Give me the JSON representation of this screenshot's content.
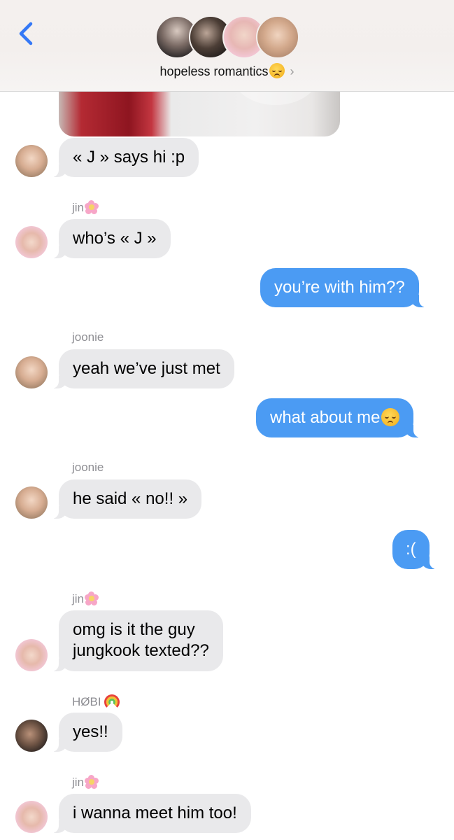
{
  "header": {
    "title": "hopeless romantics",
    "title_emoji": "pensive-face-emoji",
    "chevron": "›",
    "back_icon": "chevron-left-icon",
    "accent_color": "#3478f6",
    "group_avatars": [
      "member-photo-1",
      "member-photo-2",
      "member-photo-3",
      "member-photo-4"
    ]
  },
  "thread": {
    "incoming_bubble_color": "#e9e9eb",
    "outgoing_bubble_color": "#4b9bf3",
    "messages": [
      {
        "type": "image",
        "from": "other",
        "content": "shared-photo"
      },
      {
        "type": "text",
        "from": "other",
        "text": "« J » says hi :p"
      },
      {
        "type": "sender",
        "name": "jin",
        "emoji": "cherry-blossom-emoji"
      },
      {
        "type": "text",
        "from": "other",
        "text": "who’s « J »"
      },
      {
        "type": "text",
        "from": "me",
        "text": "you’re with him??"
      },
      {
        "type": "sender",
        "name": "joonie"
      },
      {
        "type": "text",
        "from": "other",
        "text": "yeah we’ve just met"
      },
      {
        "type": "text",
        "from": "me",
        "text": "what about me",
        "emoji": "pensive-face-emoji"
      },
      {
        "type": "sender",
        "name": "joonie"
      },
      {
        "type": "text",
        "from": "other",
        "text": "he said « no!! »"
      },
      {
        "type": "text",
        "from": "me",
        "text": ":("
      },
      {
        "type": "sender",
        "name": "jin",
        "emoji": "cherry-blossom-emoji"
      },
      {
        "type": "text",
        "from": "other",
        "lines": [
          "omg is it the guy",
          "jungkook texted??"
        ]
      },
      {
        "type": "sender",
        "name": "HØBI",
        "emoji": "rainbow-emoji"
      },
      {
        "type": "text",
        "from": "other",
        "text": "yes!!"
      },
      {
        "type": "sender",
        "name": "jin",
        "emoji": "cherry-blossom-emoji"
      },
      {
        "type": "text",
        "from": "other",
        "text": "i wanna meet him too!"
      }
    ]
  }
}
